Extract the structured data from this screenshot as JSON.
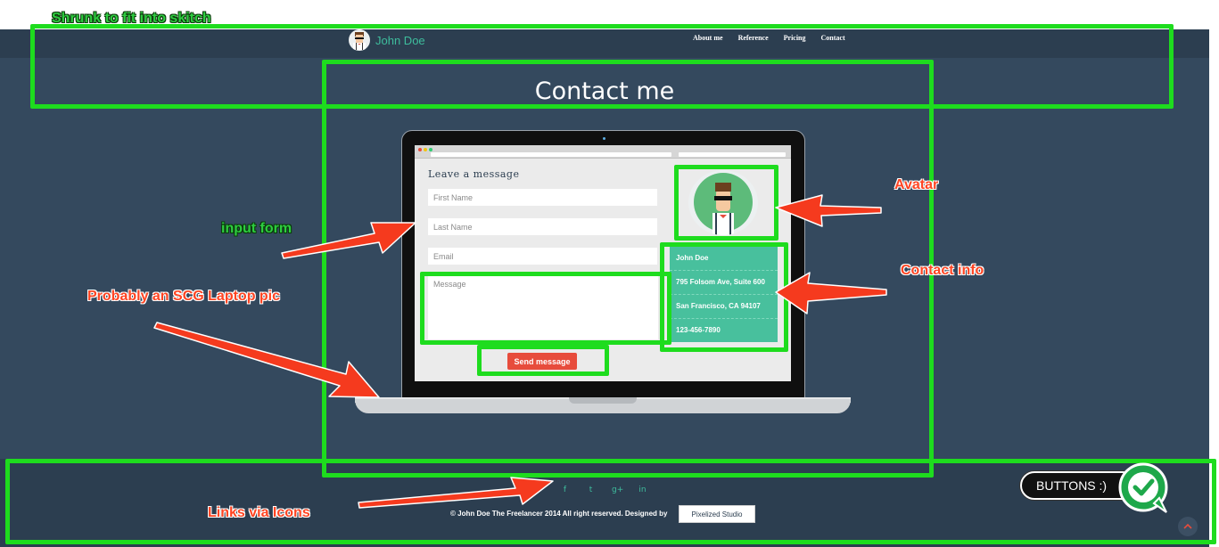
{
  "nav": {
    "brand": "John Doe",
    "links": [
      "About me",
      "Reference",
      "Pricing",
      "Contact"
    ]
  },
  "title": "Contact me",
  "form": {
    "heading": "Leave a message",
    "first_name_placeholder": "First Name",
    "last_name_placeholder": "Last Name",
    "email_placeholder": "Email",
    "message_placeholder": "Message",
    "send_label": "Send message"
  },
  "contact": {
    "name": "John Doe",
    "address": "795 Folsom Ave, Suite 600",
    "city": "San Francisco, CA 94107",
    "phone": "123-456-7890"
  },
  "footer": {
    "social": [
      "f",
      "t",
      "g+",
      "in"
    ],
    "copyright": "© John Doe The Freelancer 2014 All right reserved. Designed by",
    "studio": "Pixelized Studio"
  },
  "annotations": {
    "shrunk": "Shrunk to fit into skitch",
    "input_form": "input form",
    "laptop": "Probably an SCG Laptop pic",
    "avatar": "Avatar",
    "contact_info": "Contact info",
    "links": "Links via Icons",
    "buttons": "BUTTONS :)"
  },
  "colors": {
    "background": "#34495e",
    "navbar": "#2c3e50",
    "accent": "#3ebd9d",
    "send_button": "#e74c3c",
    "highlight": "#1edc1e",
    "annotation_red": "#ff4422"
  }
}
